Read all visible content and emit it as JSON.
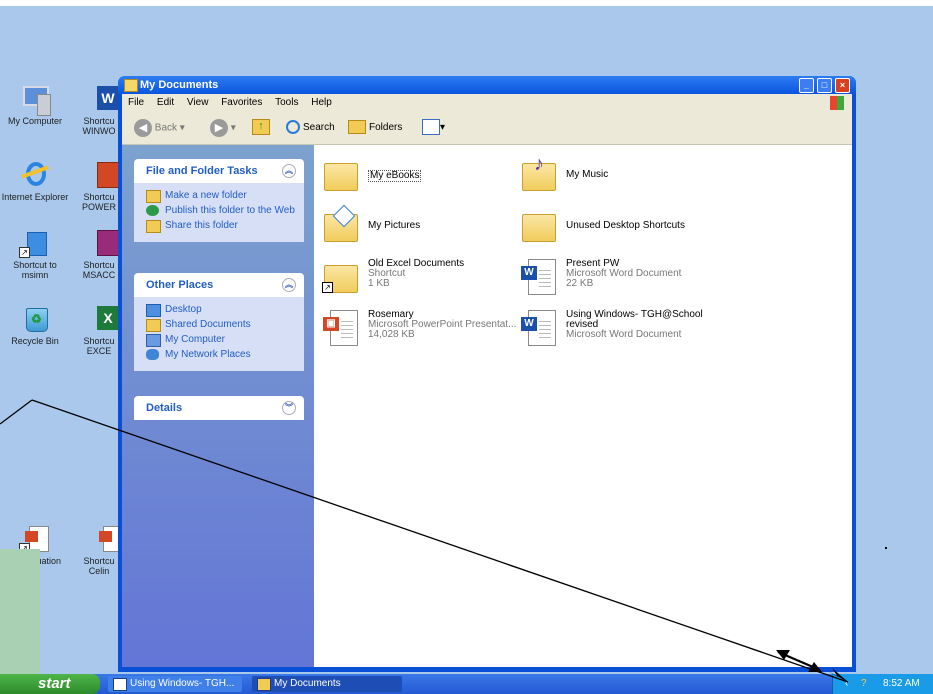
{
  "desktop": {
    "icons": [
      {
        "label": "My Computer",
        "icon": "my-computer-icon"
      },
      {
        "label": "Shortcu WINWO",
        "icon": "word-shortcut-icon"
      },
      {
        "label": "Internet Explorer",
        "icon": "internet-explorer-icon"
      },
      {
        "label": "Shortcu POWER",
        "icon": "powerpoint-shortcut-icon"
      },
      {
        "label": "Shortcut to msimn",
        "icon": "msimn-shortcut-icon"
      },
      {
        "label": "Shortcu MSACC",
        "icon": "access-shortcut-icon"
      },
      {
        "label": "Recycle Bin",
        "icon": "recycle-bin-icon"
      },
      {
        "label": "Shortcu EXCE",
        "icon": "excel-shortcut-icon"
      },
      {
        "label": "rcut to uation",
        "icon": "presentation-shortcut-icon"
      },
      {
        "label": "Shortcu Celin",
        "icon": "presentation-shortcut-icon"
      }
    ]
  },
  "window": {
    "title": "My Documents",
    "menu": [
      "File",
      "Edit",
      "View",
      "Favorites",
      "Tools",
      "Help"
    ],
    "toolbar": {
      "back_label": "Back",
      "search_label": "Search",
      "folders_label": "Folders"
    },
    "tasks_panel": {
      "title": "File and Folder Tasks",
      "items": [
        "Make a new folder",
        "Publish this folder to the Web",
        "Share this folder"
      ]
    },
    "places_panel": {
      "title": "Other Places",
      "items": [
        "Desktop",
        "Shared Documents",
        "My Computer",
        "My Network Places"
      ]
    },
    "details_panel": {
      "title": "Details"
    },
    "files": [
      {
        "name": "My eBooks",
        "kind": "folder"
      },
      {
        "name": "My Music",
        "kind": "music-folder"
      },
      {
        "name": "My Pictures",
        "kind": "pictures-folder"
      },
      {
        "name": "Unused Desktop Shortcuts",
        "kind": "folder"
      },
      {
        "name": "Old Excel Documents",
        "line2": "Shortcut",
        "line3": "1 KB",
        "kind": "folder-shortcut"
      },
      {
        "name": "Present PW",
        "line2": "Microsoft Word Document",
        "line3": "22 KB",
        "kind": "word"
      },
      {
        "name": "Rosemary",
        "line2": "Microsoft PowerPoint Presentat...",
        "line3": "14,028 KB",
        "kind": "powerpoint"
      },
      {
        "name": "Using Windows- TGH@School",
        "line2": "revised",
        "line3": "Microsoft Word Document",
        "kind": "word"
      }
    ]
  },
  "taskbar": {
    "start_label": "start",
    "tasks": [
      "Using Windows- TGH...",
      "My Documents"
    ],
    "clock": "8:52 AM"
  },
  "colors": {
    "desktop": "#a9c8ec",
    "window_frame": "#0a4fd8",
    "taskbar": "#2459d4",
    "start_button": "#3a9a36",
    "panel_link": "#215dc6"
  }
}
